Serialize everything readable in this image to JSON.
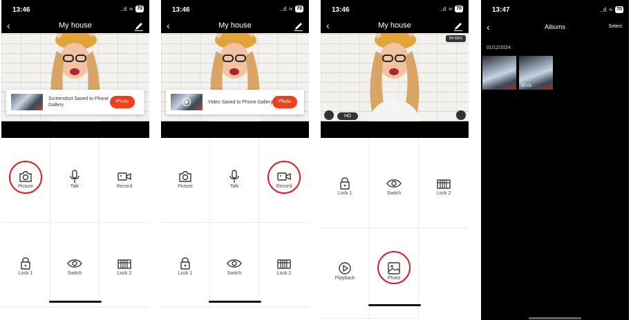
{
  "status": {
    "time1": "13:46",
    "time2": "13:46",
    "time3": "13:46",
    "time4": "13:47",
    "signal": "..ıl",
    "wifi": "≈",
    "battery": "70"
  },
  "nav": {
    "title": "My house",
    "back": "‹"
  },
  "panel1": {
    "toast": {
      "message": "Screenshot Saved to Phone Gallery",
      "button": "Photo"
    }
  },
  "panel2": {
    "toast": {
      "message": "Video Saved to Phone Gallery",
      "button": "Photo"
    }
  },
  "controls": {
    "picture": "Picture",
    "talk": "Talk",
    "record": "Record",
    "lock1": "Lock 1",
    "switch": "Switch",
    "lock2": "Lock 2"
  },
  "panel3": {
    "speed": "54 kb/s",
    "hd": "HD",
    "playback": "Playback",
    "photo": "Photo",
    "lock1": "Lock 1",
    "switch": "Switch",
    "lock2": "Lock 2"
  },
  "albums": {
    "title": "Albums",
    "select": "Select",
    "date": "01/12/2024",
    "video_duration": "00:03"
  },
  "colors": {
    "accent": "#f0401a",
    "highlight": "#e01b24"
  }
}
